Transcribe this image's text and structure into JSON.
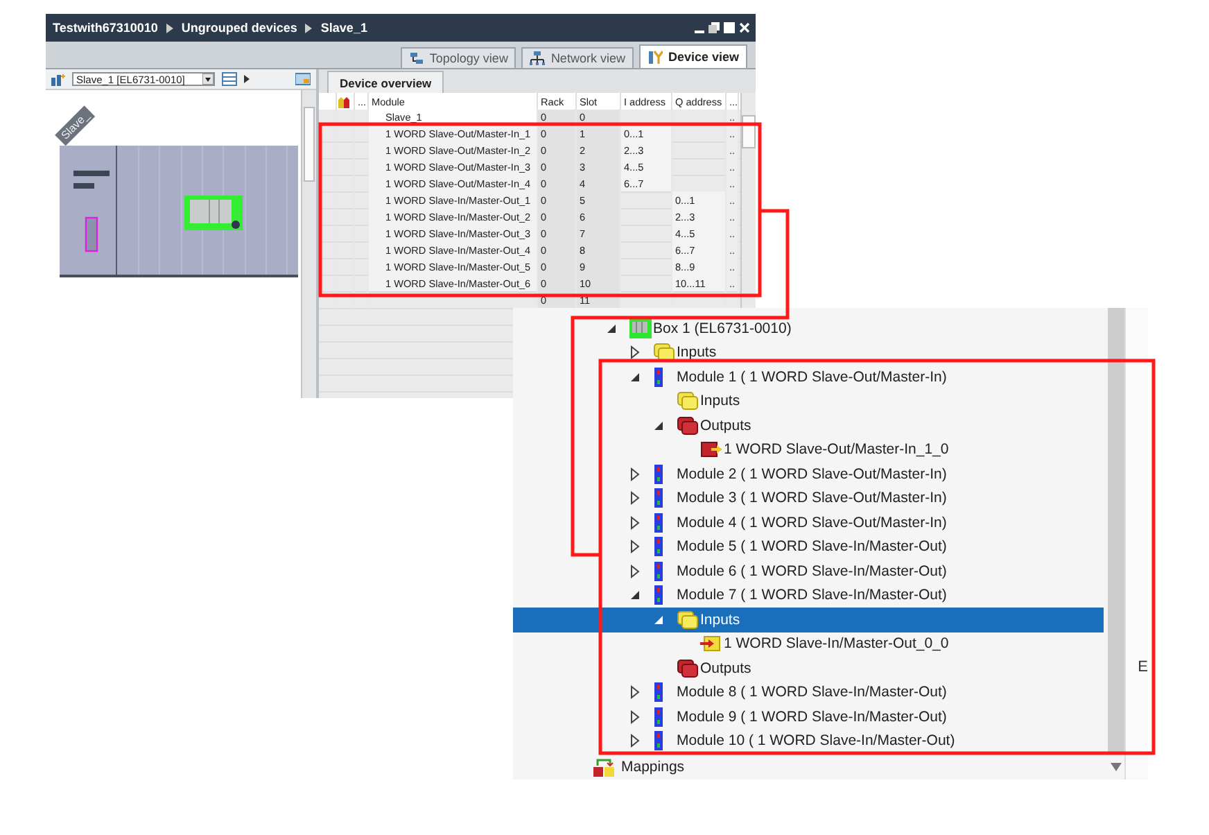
{
  "tia_window": {
    "breadcrumbs": [
      "Testwith67310010",
      "Ungrouped devices",
      "Slave_1"
    ],
    "view_tabs": [
      {
        "label": "Topology view",
        "kind": "topology",
        "selected": false
      },
      {
        "label": "Network view",
        "kind": "network",
        "selected": false
      },
      {
        "label": "Device view",
        "kind": "device",
        "selected": true
      }
    ],
    "device_selector": "Slave_1 [EL6731-0010]",
    "rack_label": "Slave_",
    "overview_tab": "Device overview",
    "table": {
      "columns": [
        "...",
        "Module",
        "Rack",
        "Slot",
        "I address",
        "Q address",
        "..."
      ],
      "rows": [
        {
          "kind": "device",
          "module": "Slave_1",
          "rack": "0",
          "slot": "0",
          "more": ".."
        },
        {
          "kind": "module",
          "module": "1 WORD Slave-Out/Master-In_1",
          "rack": "0",
          "slot": "1",
          "i_address": "0...1",
          "more": ".."
        },
        {
          "kind": "module",
          "module": "1 WORD Slave-Out/Master-In_2",
          "rack": "0",
          "slot": "2",
          "i_address": "2...3",
          "more": ".."
        },
        {
          "kind": "module",
          "module": "1 WORD Slave-Out/Master-In_3",
          "rack": "0",
          "slot": "3",
          "i_address": "4...5",
          "more": ".."
        },
        {
          "kind": "module",
          "module": "1 WORD Slave-Out/Master-In_4",
          "rack": "0",
          "slot": "4",
          "i_address": "6...7",
          "more": ".."
        },
        {
          "kind": "module",
          "module": "1 WORD Slave-In/Master-Out_1",
          "rack": "0",
          "slot": "5",
          "q_address": "0...1",
          "more": ".."
        },
        {
          "kind": "module",
          "module": "1 WORD Slave-In/Master-Out_2",
          "rack": "0",
          "slot": "6",
          "q_address": "2...3",
          "more": ".."
        },
        {
          "kind": "module",
          "module": "1 WORD Slave-In/Master-Out_3",
          "rack": "0",
          "slot": "7",
          "q_address": "4...5",
          "more": ".."
        },
        {
          "kind": "module",
          "module": "1 WORD Slave-In/Master-Out_4",
          "rack": "0",
          "slot": "8",
          "q_address": "6...7",
          "more": ".."
        },
        {
          "kind": "module",
          "module": "1 WORD Slave-In/Master-Out_5",
          "rack": "0",
          "slot": "9",
          "q_address": "8...9",
          "more": ".."
        },
        {
          "kind": "module",
          "module": "1 WORD Slave-In/Master-Out_6",
          "rack": "0",
          "slot": "10",
          "q_address": "10...11",
          "more": ".."
        },
        {
          "kind": "empty",
          "rack": "0",
          "slot": "11"
        }
      ]
    }
  },
  "tree": {
    "items": [
      {
        "label": "Box 1 (EL6731-0010)",
        "kind": "box",
        "expanded": true,
        "selected": false,
        "children": [
          {
            "label": "Inputs",
            "kind": "inputs",
            "expanded": false,
            "selected": false
          },
          {
            "label": "Module 1 ( 1 WORD Slave-Out/Master-In)",
            "kind": "module",
            "expanded": true,
            "selected": false,
            "children": [
              {
                "label": "Inputs",
                "kind": "inputs",
                "selected": false
              },
              {
                "label": "Outputs",
                "kind": "outputs",
                "expanded": true,
                "selected": false,
                "children": [
                  {
                    "label": "1 WORD Slave-Out/Master-In_1_0",
                    "kind": "output-var",
                    "selected": false
                  }
                ]
              }
            ]
          },
          {
            "label": "Module 2 ( 1 WORD Slave-Out/Master-In)",
            "kind": "module",
            "expanded": false,
            "selected": false
          },
          {
            "label": "Module 3 ( 1 WORD Slave-Out/Master-In)",
            "kind": "module",
            "expanded": false,
            "selected": false
          },
          {
            "label": "Module 4 ( 1 WORD Slave-Out/Master-In)",
            "kind": "module",
            "expanded": false,
            "selected": false
          },
          {
            "label": "Module 5 ( 1 WORD Slave-In/Master-Out)",
            "kind": "module",
            "expanded": false,
            "selected": false
          },
          {
            "label": "Module 6 ( 1 WORD Slave-In/Master-Out)",
            "kind": "module",
            "expanded": false,
            "selected": false
          },
          {
            "label": "Module 7 ( 1 WORD Slave-In/Master-Out)",
            "kind": "module",
            "expanded": true,
            "selected": false,
            "children": [
              {
                "label": "Inputs",
                "kind": "inputs",
                "expanded": true,
                "selected": true,
                "children": [
                  {
                    "label": "1 WORD Slave-In/Master-Out_0_0",
                    "kind": "input-var",
                    "selected": false
                  }
                ]
              },
              {
                "label": "Outputs",
                "kind": "outputs",
                "selected": false
              }
            ]
          },
          {
            "label": "Module 8 ( 1 WORD Slave-In/Master-Out)",
            "kind": "module",
            "expanded": false,
            "selected": false
          },
          {
            "label": "Module 9 ( 1 WORD Slave-In/Master-Out)",
            "kind": "module",
            "expanded": false,
            "selected": false
          },
          {
            "label": "Module 10 ( 1 WORD Slave-In/Master-Out)",
            "kind": "module",
            "expanded": false,
            "selected": false
          }
        ]
      }
    ],
    "footer_item": {
      "label": "Mappings",
      "kind": "mappings",
      "selected": false
    },
    "side_label": "E"
  }
}
